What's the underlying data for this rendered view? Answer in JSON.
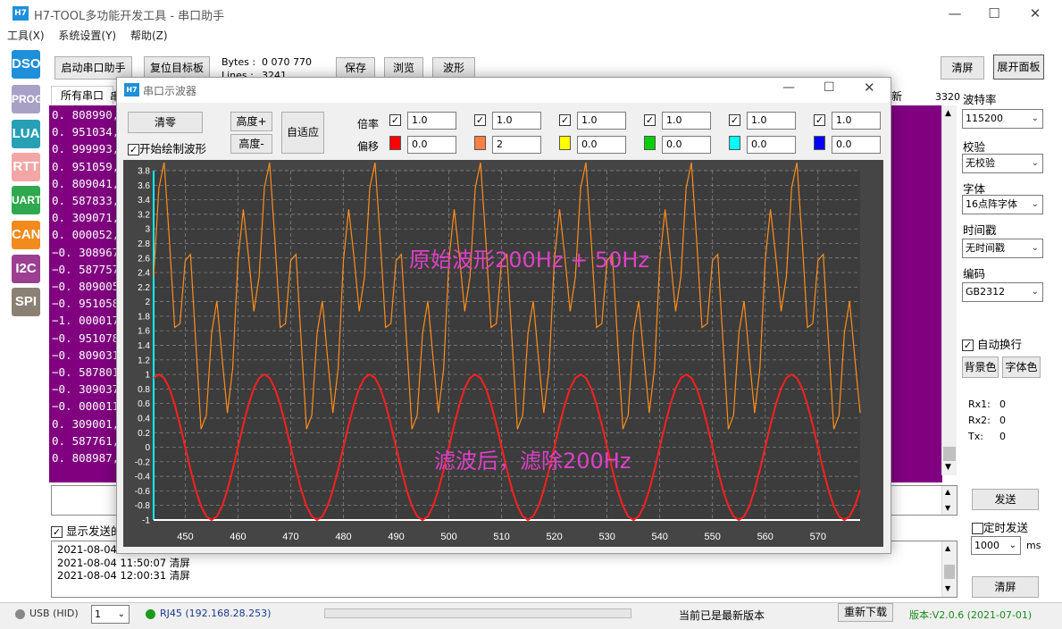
{
  "app": {
    "logo": "H7",
    "title": "H7-TOOL多功能开发工具 - 串口助手",
    "win_min": "—",
    "win_max": "☐",
    "win_close": "✕"
  },
  "menu": [
    "工具(X)",
    "系统设置(Y)",
    "帮助(Z)"
  ],
  "sidebar": [
    {
      "label": "DSO",
      "color": "#1e8fd8"
    },
    {
      "label": "PROG",
      "color": "#a9a0c6"
    },
    {
      "label": "LUA",
      "color": "#27a0b5"
    },
    {
      "label": "RTT",
      "color": "#f4a6a6"
    },
    {
      "label": "UART",
      "color": "#2fa84f"
    },
    {
      "label": "CAN",
      "color": "#f28a1c"
    },
    {
      "label": "I2C",
      "color": "#9c3f90"
    },
    {
      "label": "SPI",
      "color": "#8a8073"
    }
  ],
  "toolbar": {
    "start": "启动串口助手",
    "reset": "复位目标板",
    "bytes_label": "Bytes :",
    "bytes_value": "0 070 770",
    "lines_label": "Lines :",
    "lines_value": "3241",
    "save": "保存",
    "browse": "浏览",
    "waveform": "波形",
    "clear": "清屏",
    "expand": "展开面板"
  },
  "tabs": {
    "all": "所有串口",
    "partial": "串",
    "new": "新",
    "count": "3320"
  },
  "terminal": [
    "0. 808990,",
    "0. 951034,",
    "0. 999993,",
    "0. 951059,",
    "0. 809041,",
    "0. 587833,",
    "0. 309071,",
    "0. 000052,",
    "−0. 308967",
    "−0. 587757",
    "−0. 809005",
    "−0. 951058",
    "−1. 000017",
    "−0. 951078",
    "−0. 809031",
    "−0. 587801",
    "−0. 309037",
    "−0. 000011",
    "0. 309001,",
    "0. 587761,",
    "0. 808987,"
  ],
  "right_panel": {
    "baud_label": "波特率",
    "baud": "115200",
    "parity_label": "校验",
    "parity": "无校验",
    "font_label": "字体",
    "font": "16点阵字体",
    "timestamp_label": "时间戳",
    "timestamp": "无时间戳",
    "encoding_label": "编码",
    "encoding": "GB2312",
    "autowrap": "自动换行",
    "bg_color": "背景色",
    "font_color": "字体色",
    "rx1_label": "Rx1:",
    "rx1": "0",
    "rx2_label": "Rx2:",
    "rx2": "0",
    "tx_label": "Tx:",
    "tx": "0",
    "send": "发送",
    "timed_send": "定时发送",
    "interval": "1000",
    "interval_unit": "ms",
    "clear": "清屏"
  },
  "show_sent": "显示发送的",
  "log": [
    "2021-08-04 1",
    "2021-08-04 11:50:07 清屏",
    "2021-08-04 12:00:31 清屏"
  ],
  "osc": {
    "logo": "H7",
    "title": "串口示波器",
    "clear": "清零",
    "height_plus": "高度+",
    "height_minus": "高度-",
    "autofit": "自适应",
    "start_draw": "开始绘制波形",
    "scale_label": "倍率",
    "offset_label": "偏移",
    "channels": [
      {
        "color": "#ff0000",
        "scale": "1.0",
        "offset": "0.0"
      },
      {
        "color": "#ff8040",
        "scale": "1.0",
        "offset": "2"
      },
      {
        "color": "#ffff00",
        "scale": "1.0",
        "offset": "0.0"
      },
      {
        "color": "#00d000",
        "scale": "1.0",
        "offset": "0.0"
      },
      {
        "color": "#00ffff",
        "scale": "1.0",
        "offset": "0.0"
      },
      {
        "color": "#0000ff",
        "scale": "1.0",
        "offset": "0.0"
      }
    ]
  },
  "chart_data": {
    "type": "line",
    "xlim": [
      444,
      578
    ],
    "ylim": [
      -1,
      3.8
    ],
    "x_ticks": [
      "450",
      "460",
      "470",
      "480",
      "490",
      "500",
      "510",
      "520",
      "530",
      "540",
      "550",
      "560",
      "570"
    ],
    "y_ticks": [
      "3.8",
      "3.6",
      "3.4",
      "3.2",
      "3",
      "2.8",
      "2.6",
      "2.4",
      "2.2",
      "2",
      "1.8",
      "1.6",
      "1.4",
      "1.2",
      "1",
      "0.8",
      "0.6",
      "0.4",
      "0.2",
      "0",
      "-0.2",
      "-0.4",
      "-0.6",
      "-0.8",
      "-1"
    ],
    "annotations": [
      "原始波形200Hz + 50Hz",
      "滤波后，滤除200Hz"
    ],
    "grid": true,
    "series": [
      {
        "color": "#ff8c1a",
        "samples_per_cycle_50hz": 20,
        "samples_per_cycle_200hz": 5,
        "offset": 2,
        "amplitude_50hz": 1,
        "amplitude_200hz": 1
      },
      {
        "color": "#ff1f1f",
        "samples_per_cycle_50hz": 20,
        "offset": 0,
        "amplitude_50hz": 1
      }
    ],
    "colors": {
      "bg": "#454545",
      "plot": "#3c3c3c",
      "axis": "#ffffff",
      "y_axis": "#00ffff",
      "annotation": "#e040c8"
    }
  },
  "status": {
    "usb": "USB (HID)",
    "port": "1",
    "rj45": "RJ45 (192.168.28.253)",
    "version_msg": "当前已是最新版本",
    "redownload": "重新下载",
    "version": "版本:V2.0.6 (2021-07-01)"
  }
}
